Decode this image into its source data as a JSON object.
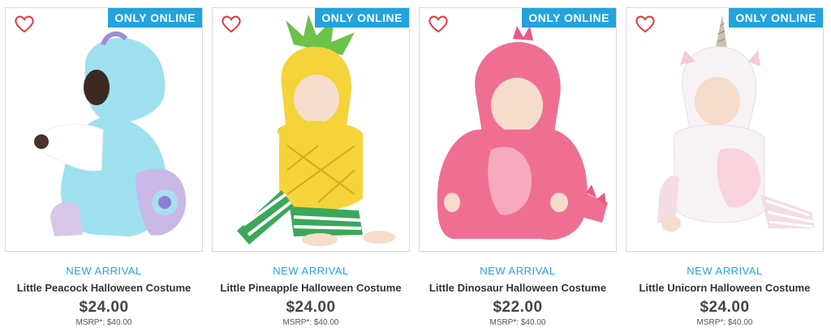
{
  "products": [
    {
      "badge": "ONLY ONLINE",
      "tag": "NEW ARRIVAL",
      "name": "Little Peacock Halloween Costume",
      "price": "$24.00",
      "msrp": "MSRP*: $40.00",
      "image": "peacock-costume-photo",
      "costume_color": "#9fe0ef"
    },
    {
      "badge": "ONLY ONLINE",
      "tag": "NEW ARRIVAL",
      "name": "Little Pineapple Halloween Costume",
      "price": "$24.00",
      "msrp": "MSRP*: $40.00",
      "image": "pineapple-costume-photo",
      "costume_color": "#f5d33a"
    },
    {
      "badge": "ONLY ONLINE",
      "tag": "NEW ARRIVAL",
      "name": "Little Dinosaur Halloween Costume",
      "price": "$22.00",
      "msrp": "MSRP*: $40.00",
      "image": "dinosaur-costume-photo",
      "costume_color": "#ef6f93"
    },
    {
      "badge": "ONLY ONLINE",
      "tag": "NEW ARRIVAL",
      "name": "Little Unicorn Halloween Costume",
      "price": "$24.00",
      "msrp": "MSRP*: $40.00",
      "image": "unicorn-costume-photo",
      "costume_color": "#f7f2f4"
    }
  ],
  "colors": {
    "accent": "#22a3dd",
    "heart": "#e8363c",
    "price": "#444444"
  },
  "icons": {
    "favorite": "heart-outline-icon"
  }
}
